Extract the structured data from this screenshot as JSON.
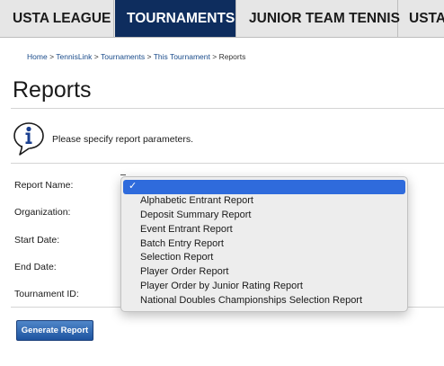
{
  "nav": {
    "tabs": [
      {
        "label": "USTA LEAGUE",
        "active": false
      },
      {
        "label": "TOURNAMENTS",
        "active": true
      },
      {
        "label": "JUNIOR TEAM TENNIS",
        "active": false
      },
      {
        "label": "USTA",
        "active": false
      }
    ]
  },
  "breadcrumb": {
    "items": [
      "Home",
      "TennisLink",
      "Tournaments",
      "This Tournament",
      "Reports"
    ],
    "separator": ">"
  },
  "page": {
    "title": "Reports"
  },
  "info": {
    "icon": "info-icon",
    "message": "Please specify report parameters."
  },
  "form": {
    "labels": {
      "report_name": "Report Name:",
      "organization": "Organization:",
      "start_date": "Start Date:",
      "end_date": "End Date:",
      "tournament_id": "Tournament ID:"
    },
    "generate_button": "Generate Report"
  },
  "dropdown": {
    "selected_index": 0,
    "check_mark": "✓",
    "options": [
      "",
      "Alphabetic Entrant Report",
      "Deposit Summary Report",
      "Event Entrant Report",
      "Batch Entry Report",
      "Selection Report",
      "Player Order Report",
      "Player Order by Junior Rating Report",
      "National Doubles Championships Selection Report"
    ]
  },
  "colors": {
    "nav_active": "#0e2d5e",
    "link": "#1a4c8b",
    "selection": "#2f6bdc",
    "button": "#1e54a0"
  }
}
